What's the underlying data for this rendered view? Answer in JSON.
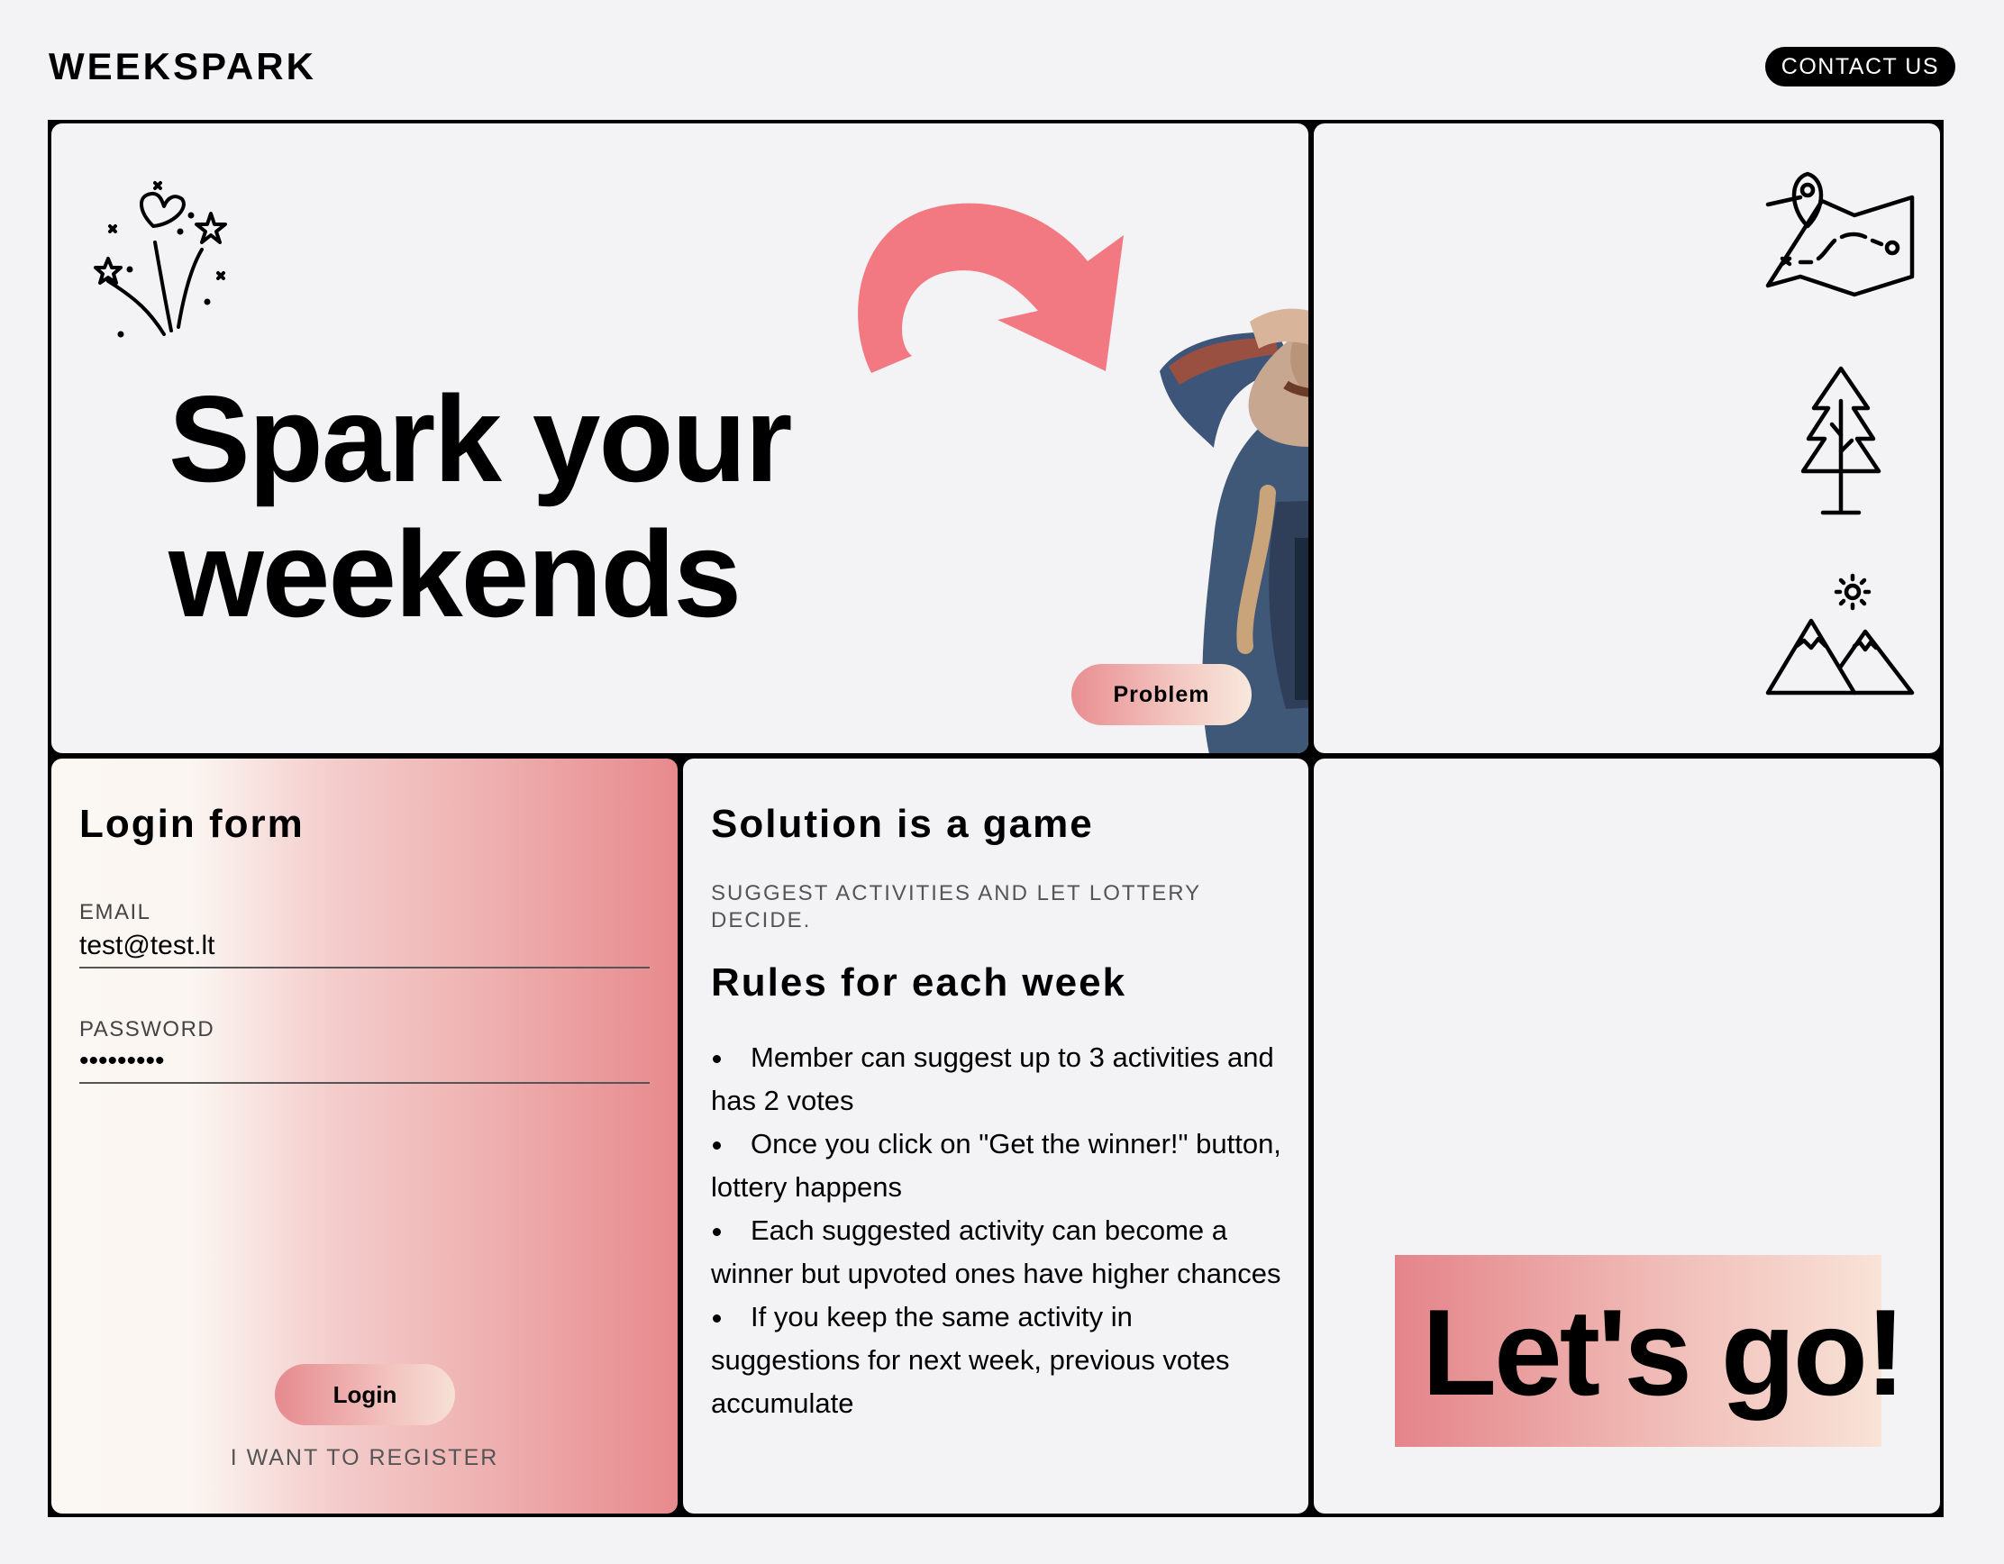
{
  "header": {
    "logo": "WEEKSPARK",
    "contact_label": "CONTACT US"
  },
  "hero": {
    "title_line1": "Spark your",
    "title_line2": "weekends",
    "problem_label": "Problem"
  },
  "login": {
    "title": "Login form",
    "email_label": "EMAIL",
    "email_value": "test@test.lt",
    "password_label": "PASSWORD",
    "password_value": "•••••••••",
    "login_label": "Login",
    "register_label": "I WANT TO REGISTER"
  },
  "solution": {
    "title": "Solution is a game",
    "subtitle": "SUGGEST ACTIVITIES AND LET LOTTERY DECIDE.",
    "rules_title": "Rules for each week",
    "rules": [
      "Member can suggest up to 3 activities and has 2 votes",
      "Once you click on \"Get the winner!\" button, lottery happens",
      "Each suggested activity can become a winner but upvoted ones have higher chances",
      "If you keep the same activity in suggestions for next week, previous votes accumulate"
    ]
  },
  "cta": {
    "text": "Let's go!"
  },
  "colors": {
    "accent": "#f27981",
    "background": "#f3f2f5",
    "frame": "#000000"
  },
  "icons": [
    "fireworks-icon",
    "curved-arrow-icon",
    "map-icon",
    "tree-icon",
    "mountains-sun-icon"
  ]
}
